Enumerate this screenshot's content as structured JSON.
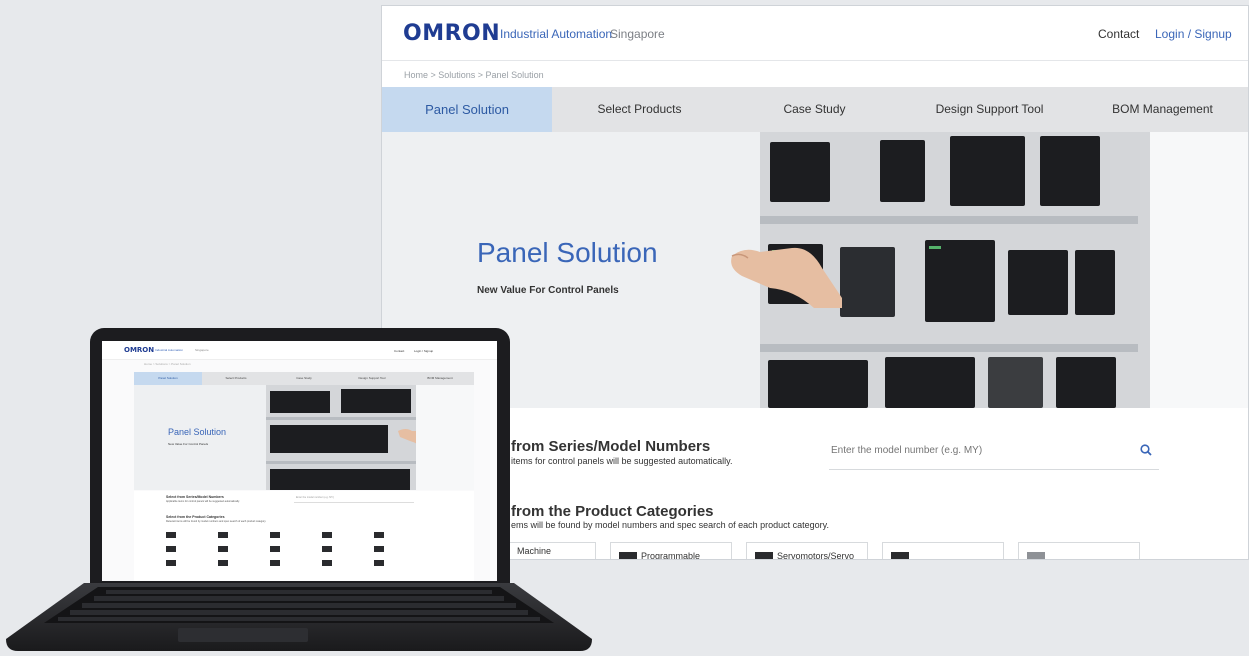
{
  "site": {
    "logo": "OMRON",
    "logo_sub": "Industrial Automation",
    "region": "Singapore",
    "header_links": {
      "contact": "Contact",
      "login": "Login / Signup"
    },
    "breadcrumb": "Home  >  Solutions  >  Panel Solution",
    "nav": [
      "Panel Solution",
      "Select Products",
      "Case Study",
      "Design Support Tool",
      "BOM Management"
    ],
    "nav_active": "Panel Solution",
    "hero": {
      "title": "Panel Solution",
      "subtitle": "New Value For Control Panels"
    },
    "series_search": {
      "title": "from Series/Model Numbers",
      "desc": "items for control panels will be suggested automatically.",
      "placeholder": "Enter the model number (e.g. MY)"
    },
    "categories": {
      "title": "from the Product Categories",
      "desc": "ems will be found by model numbers and spec search of each product category.",
      "cards": [
        "Machine",
        "Programmable",
        "Servomotors/Servo",
        "",
        ""
      ]
    }
  },
  "laptop_site": {
    "logo": "OMRON",
    "logo_sub": "Industrial Automation",
    "region": "Singapore",
    "header_links": {
      "contact": "Contact",
      "login": "Login / Signup"
    },
    "breadcrumb": "Home  >  Solutions  >  Panel Solution",
    "nav": [
      "Panel Solution",
      "Select Products",
      "Case Study",
      "Design Support Tool",
      "BOM Management"
    ],
    "hero": {
      "title": "Panel Solution",
      "subtitle": "New Value For Control Panels"
    },
    "series_title": "Select from Series/Model Numbers",
    "series_desc": "Applicable items for control panels will be suggested automatically.",
    "series_placeholder": "Enter the model number (e.g. MY)",
    "categories_title": "Select from the Product Categories",
    "categories_desc": "Relevant items will be found by model numbers and spec search of each product category."
  },
  "colors": {
    "brand": "#1f3c92",
    "accent": "#3a66b8",
    "nav_active_bg": "#c5d9ef",
    "nav_bg": "#e2e3e5",
    "page_bg": "#e7e9ec"
  }
}
